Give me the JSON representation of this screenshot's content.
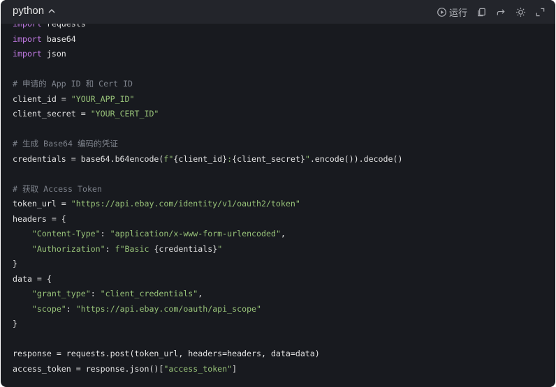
{
  "header": {
    "language": "python",
    "run_label": "运行",
    "icons": [
      "chevron-up-icon",
      "play-circle-icon",
      "copy-icon",
      "share-icon",
      "theme-sun-icon",
      "expand-icon"
    ]
  },
  "code": {
    "lines": [
      [
        {
          "t": "kw",
          "s": "import"
        },
        {
          "t": "pl",
          "s": " requests"
        }
      ],
      [
        {
          "t": "kw",
          "s": "import"
        },
        {
          "t": "pl",
          "s": " base64"
        }
      ],
      [
        {
          "t": "kw",
          "s": "import"
        },
        {
          "t": "pl",
          "s": " json"
        }
      ],
      [],
      [
        {
          "t": "cm",
          "s": "# 申请的 App ID 和 Cert ID"
        }
      ],
      [
        {
          "t": "pl",
          "s": "client_id = "
        },
        {
          "t": "str",
          "s": "\"YOUR_APP_ID\""
        }
      ],
      [
        {
          "t": "pl",
          "s": "client_secret = "
        },
        {
          "t": "str",
          "s": "\"YOUR_CERT_ID\""
        }
      ],
      [],
      [
        {
          "t": "cm",
          "s": "# 生成 Base64 编码的凭证"
        }
      ],
      [
        {
          "t": "pl",
          "s": "credentials = base64.b64encode("
        },
        {
          "t": "str",
          "s": "f\""
        },
        {
          "t": "pl",
          "s": "{client_id}"
        },
        {
          "t": "str",
          "s": ":"
        },
        {
          "t": "pl",
          "s": "{client_secret}"
        },
        {
          "t": "str",
          "s": "\""
        },
        {
          "t": "pl",
          "s": ".encode()).decode()"
        }
      ],
      [],
      [
        {
          "t": "cm",
          "s": "# 获取 Access Token"
        }
      ],
      [
        {
          "t": "pl",
          "s": "token_url = "
        },
        {
          "t": "str",
          "s": "\"https://api.ebay.com/identity/v1/oauth2/token\""
        }
      ],
      [
        {
          "t": "pl",
          "s": "headers = {"
        }
      ],
      [
        {
          "t": "pl",
          "s": "    "
        },
        {
          "t": "str",
          "s": "\"Content-Type\""
        },
        {
          "t": "pl",
          "s": ": "
        },
        {
          "t": "str",
          "s": "\"application/x-www-form-urlencoded\""
        },
        {
          "t": "pl",
          "s": ","
        }
      ],
      [
        {
          "t": "pl",
          "s": "    "
        },
        {
          "t": "str",
          "s": "\"Authorization\""
        },
        {
          "t": "pl",
          "s": ": "
        },
        {
          "t": "str",
          "s": "f\"Basic "
        },
        {
          "t": "pl",
          "s": "{credentials}"
        },
        {
          "t": "str",
          "s": "\""
        }
      ],
      [
        {
          "t": "pl",
          "s": "}"
        }
      ],
      [
        {
          "t": "pl",
          "s": "data = {"
        }
      ],
      [
        {
          "t": "pl",
          "s": "    "
        },
        {
          "t": "str",
          "s": "\"grant_type\""
        },
        {
          "t": "pl",
          "s": ": "
        },
        {
          "t": "str",
          "s": "\"client_credentials\""
        },
        {
          "t": "pl",
          "s": ","
        }
      ],
      [
        {
          "t": "pl",
          "s": "    "
        },
        {
          "t": "str",
          "s": "\"scope\""
        },
        {
          "t": "pl",
          "s": ": "
        },
        {
          "t": "str",
          "s": "\"https://api.ebay.com/oauth/api_scope\""
        }
      ],
      [
        {
          "t": "pl",
          "s": "}"
        }
      ],
      [],
      [
        {
          "t": "pl",
          "s": "response = requests.post(token_url, headers=headers, data=data)"
        }
      ],
      [
        {
          "t": "pl",
          "s": "access_token = response.json()["
        },
        {
          "t": "str",
          "s": "\"access_token\""
        },
        {
          "t": "pl",
          "s": "]"
        }
      ]
    ]
  },
  "colors": {
    "background": "#181a1f",
    "header": "#23252b",
    "keyword": "#c77dea",
    "string": "#98c379",
    "comment": "#7e838c",
    "text": "#e4e4e4"
  }
}
